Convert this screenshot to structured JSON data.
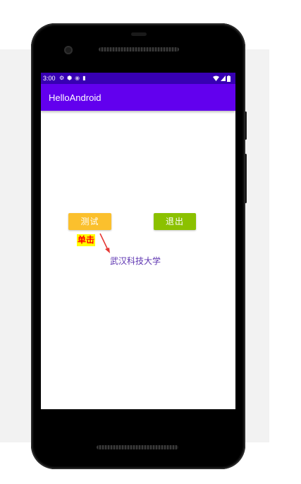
{
  "status_bar": {
    "time": "3:00"
  },
  "app_bar": {
    "title": "HelloAndroid"
  },
  "content": {
    "test_button": "测试",
    "exit_button": "退出",
    "click_label": "单击",
    "school_text": "武汉科技大学"
  },
  "colors": {
    "status_bar": "#3700b3",
    "app_bar": "#6200ee",
    "test_button": "#fbc02d",
    "exit_button": "#8bc100",
    "click_label_bg": "#ffff00",
    "click_label_text": "#ff0000",
    "school_text": "#5e35b1",
    "arrow": "#e53935"
  }
}
